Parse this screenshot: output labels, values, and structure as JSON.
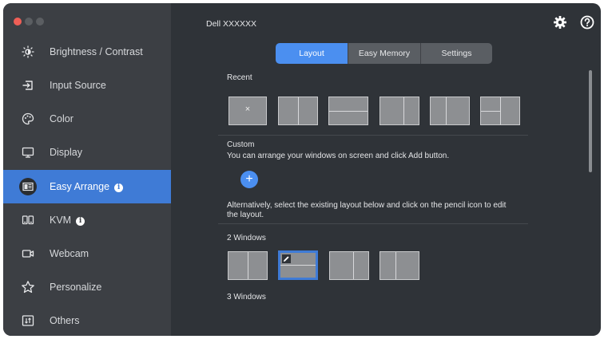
{
  "window": {
    "traffic_lights": [
      "close",
      "minimize",
      "zoom"
    ]
  },
  "sidebar": {
    "items": [
      {
        "label": "Brightness / Contrast",
        "icon": "sun-icon"
      },
      {
        "label": "Input Source",
        "icon": "input-source-icon"
      },
      {
        "label": "Color",
        "icon": "palette-icon"
      },
      {
        "label": "Display",
        "icon": "monitor-icon"
      },
      {
        "label": "Easy Arrange",
        "icon": "easy-arrange-icon",
        "active": true,
        "info_badge": "i"
      },
      {
        "label": "KVM",
        "icon": "kvm-icon",
        "info_badge": "i"
      },
      {
        "label": "Webcam",
        "icon": "webcam-icon"
      },
      {
        "label": "Personalize",
        "icon": "star-icon"
      },
      {
        "label": "Others",
        "icon": "others-icon"
      }
    ]
  },
  "header": {
    "monitor_name": "Dell XXXXXX",
    "settings_icon": "gear-icon",
    "help_icon": "help-icon"
  },
  "tabs": [
    {
      "label": "Layout",
      "active": true
    },
    {
      "label": "Easy Memory",
      "active": false
    },
    {
      "label": "Settings",
      "active": false
    }
  ],
  "content": {
    "recent_label": "Recent",
    "recent_empty_mark": "×",
    "custom_label": "Custom",
    "custom_text": "You can arrange your windows on screen and click Add button.",
    "add_symbol": "+",
    "alternative_text_line1": "Alternatively, select the existing layout below and click on the pencil icon to edit",
    "alternative_text_line2": "the layout.",
    "two_windows_label": "2 Windows",
    "three_windows_label": "3 Windows"
  },
  "colors": {
    "accent": "#4b8ff0",
    "sidebar_active": "#3f7bd6",
    "sidebar_bg": "#3c3f44",
    "main_bg": "#2f3338"
  }
}
